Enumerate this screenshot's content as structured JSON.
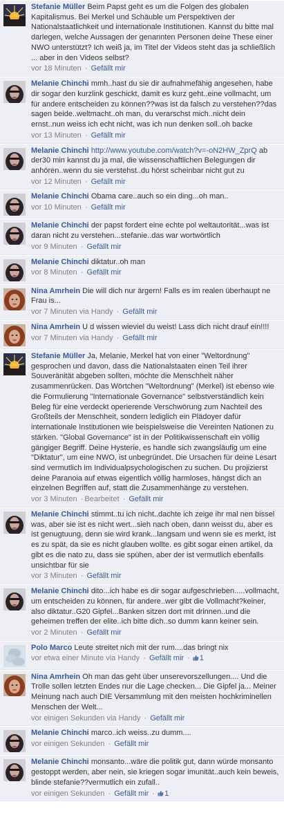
{
  "comments": [
    {
      "author": "Stefanie Müller",
      "avatar": "stefanie",
      "text": "Beim Papst geht es um die Folgen des globalen Kapitalismus. Bei Merkel und Schäuble um Perspektiven der Nationalstaatlichkeit und internationale Institutionen. Kannst du bitte mal darlegen, welche Aussagen der genannten Personen deine These einer NWO unterstützt? Ich weiß ja, im Titel der Videos steht das ja schließlich ... aber in den Videos selbst?",
      "time": "vor 18 Minuten",
      "like": "Gefällt mir"
    },
    {
      "author": "Melanie Chinchi",
      "avatar": "melanie",
      "text": "mmh..hast du sie dir aufnahmefähig angesehen, habe dir sogar den kurzlink geschickt, damit es kurz geht..eine vollmacht, um für andere entscheiden zu können??was ist da falsch zu verstehen??das sagen beide..weltmacht..oh man, du verarschst mich..nicht dein ernst..nun weiss ich echt nicht, was ich nun denken soll..oh backe",
      "time": "vor 13 Minuten",
      "like": "Gefällt mir"
    },
    {
      "author": "Melanie Chinchi",
      "avatar": "melanie",
      "link": "http://www.youtube.com/watch?v=-oN2HW_ZprQ",
      "text": "ab der30 min kannst du ja mal, die wissenschaftlichen Belegungen dir anhören..wenn du sie verstehst..du hörst scheinbar nicht gut zu",
      "time": "vor 12 Minuten",
      "like": "Gefällt mir"
    },
    {
      "author": "Melanie Chinchi",
      "avatar": "melanie",
      "text": "Obama care..auch so ein ding...oh man..",
      "time": "vor 10 Minuten",
      "like": "Gefällt mir"
    },
    {
      "author": "Melanie Chinchi",
      "avatar": "melanie",
      "text": "der papst fordert eine echte pol weltautorität...was ist daran nicht zu verstehen...stefanie..das war wortwörtlich",
      "time": "vor 9 Minuten",
      "like": "Gefällt mir"
    },
    {
      "author": "Melanie Chinchi",
      "avatar": "melanie",
      "text": "diktatur..oh man",
      "time": "vor 8 Minuten",
      "like": "Gefällt mir"
    },
    {
      "author": "Nina Amrhein",
      "avatar": "nina",
      "text": "Die will dich nur ärgern! Falls es im realen überhaupt ne Frau is...",
      "time": "vor 7 Minuten via Handy",
      "like": "Gefällt mir"
    },
    {
      "author": "Nina Amrhein",
      "avatar": "nina",
      "text": "U d wissen wieviel du weist! Lass dich nicht drauf ein!!!!",
      "time": "vor 7 Minuten via Handy",
      "like": "Gefällt mir"
    },
    {
      "author": "Stefanie Müller",
      "avatar": "stefanie",
      "text": "Ja, Melanie, Merkel hat von einer \"Weltordnung\" gesprochen und davon, dass die Nationalstaaten einen Teil ihrer Souveränität abgeben sollten, möchte die Menschheit näher zusammenrücken. Das Wörtchen \"Weltordnung\" (Merkel) ist ebenso wie die Formulierung \"Internationale Governance\" selbstverständlich kein Beleg für eine verdeckt operierende Verschwörung zum Nachteil des Großteils der Menschheit, sondern lediglich ein Plädoyer dafür internationale Institutionen wie beispielsweise die Vereinten Nationen zu stärken. \"Global Governance\" ist in der Politikwissenschaft ein völlig gängiger Begriff. Deine Hysterie, es handle sich zwangsläufig um eine \"Diktatur\", um eine NWO, ist unbegründet. Die Ursachen für deine Lesart sind vermutlich im Individualpsychologischen zu suchen. Du projizierst deine Paranoia auf etwas eigentlich völlig harmloses, hängst dich an einzelnen Begriffen auf, statt die Zusammenhänge zu verstehen.",
      "time": "vor 3 Minuten",
      "edited": "Bearbeitet",
      "like": "Gefällt mir"
    },
    {
      "author": "Melanie Chinchi",
      "avatar": "melanie",
      "text": "stimmt..tu ich nicht..dachte ich zeige ihr mal nen bissel was, aber sie ist es nicht wert...sieh nach oben, dann weisst du, aber es ist genugtuung, denn sie wird krank...langsam und wenn sie es merkt, ist es zu spät, da sie es nicht glauben wollte. es gibt sogar einen artikel, da gibt es die nato zu, dass sie spühen, aber der ist vermutlich ebenfalls unsichtbar für sie",
      "time": "vor 3 Minuten",
      "like": "Gefällt mir"
    },
    {
      "author": "Melanie Chinchi",
      "avatar": "melanie",
      "text": "dito...ich habe es dir sogar aufgeschrieben.....vollmacht, um entscheiden zu können, für andere..wer gibt die Vollmacht?keiner, also diktatur..G20 Gipfel...Banken sitzen dort mit drinnen..und die geheimen treffen der elite..ich bitte dich..so dumm kann keiner sein.",
      "time": "vor 2 Minuten",
      "like": "Gefällt mir"
    },
    {
      "author": "Polo Marco",
      "avatar": "polo",
      "text": "Leute streitet nich mit der rum....das bringt nix",
      "time": "vor etwa einer Minute via Handy",
      "like": "Gefällt mir",
      "likes": "1"
    },
    {
      "author": "Nina Amrhein",
      "avatar": "nina",
      "text": "Oh man das geht über unserevorszellungen.... Und die Trolle sollen letzten Endes nur die Lage checken... Die Gipfel ja... Meiner Meinung nach auch DIE Versammlung mit den meisten hochkriminellen Menschen der Welt...",
      "time": "vor einigen Sekunden via Handy",
      "like": "Gefällt mir"
    },
    {
      "author": "Melanie Chinchi",
      "avatar": "melanie",
      "text": "marco..ich weiss..zu dumm....",
      "time": "vor einigen Sekunden",
      "like": "Gefällt mir"
    },
    {
      "author": "Melanie Chinchi",
      "avatar": "melanie",
      "text": "monsanto...wäre die politik gut, dann würde monsanto gestoppt werden, aber nein, sie kriegen sogar imunität..auch kein beweis, blinde stefanie??vermutlich ein zufall..",
      "time": "vor einigen Sekunden",
      "like": "Gefällt mir",
      "likes": "1"
    }
  ]
}
